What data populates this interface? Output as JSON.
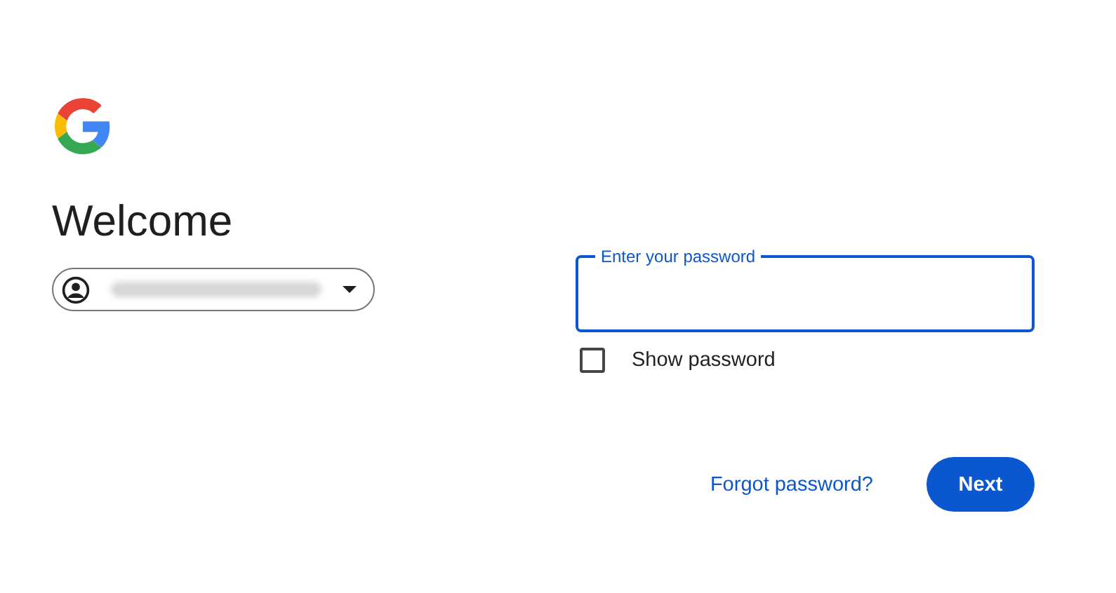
{
  "heading": "Welcome",
  "password_field": {
    "placeholder": "Enter your password",
    "focused": true
  },
  "show_password": {
    "label": "Show password",
    "checked": false
  },
  "forgot_link": "Forgot password?",
  "next_button": "Next"
}
